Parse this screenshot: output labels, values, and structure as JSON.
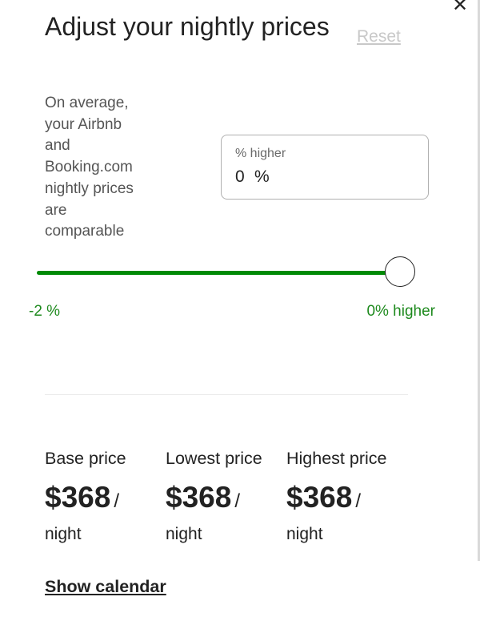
{
  "dialog": {
    "close_icon": "close-icon",
    "close_glyph": "✕",
    "title": "Adjust your nightly prices",
    "reset_label": "Reset"
  },
  "comparison": {
    "description": "On average, your Airbnb and Booking.com nightly prices are comparable",
    "field_label": "% higher",
    "field_value": "0",
    "field_unit": "%"
  },
  "slider": {
    "min_label": "-2 %",
    "max_label": "0% higher",
    "value_fraction": 1.0,
    "fill_color": "#008a05",
    "label_color": "#1e8a1e"
  },
  "prices": [
    {
      "title": "Base price",
      "amount": "$368",
      "slash": "/",
      "unit": "night"
    },
    {
      "title": "Lowest price",
      "amount": "$368",
      "slash": "/",
      "unit": "night"
    },
    {
      "title": "Highest price",
      "amount": "$368",
      "slash": "/",
      "unit": "night"
    }
  ],
  "show_calendar_label": "Show calendar"
}
